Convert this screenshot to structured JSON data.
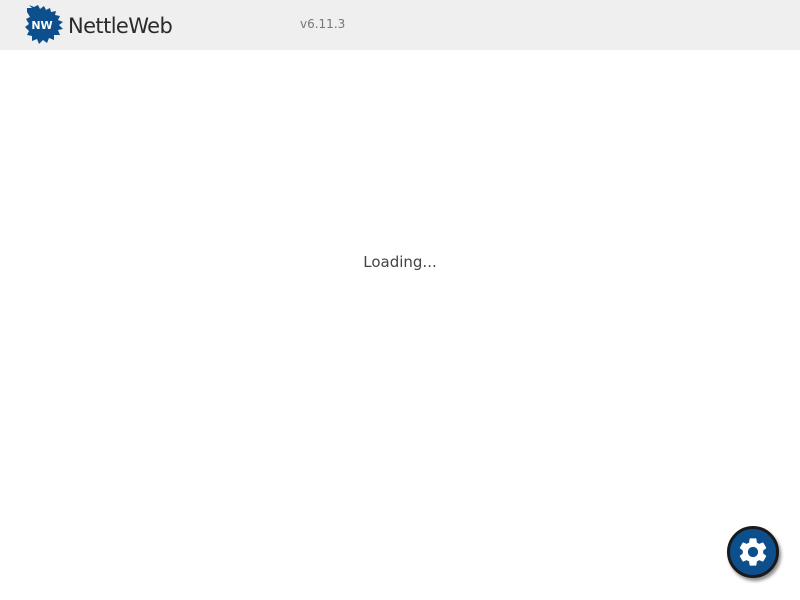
{
  "header": {
    "logo": {
      "badge_text": "NW",
      "name": "NettleWeb",
      "icon": "leaf-logo-icon",
      "leaf_color": "#0d4f8d"
    },
    "version": "v6.11.3"
  },
  "main": {
    "status_text": "Loading..."
  },
  "settings_button": {
    "icon": "gear-icon",
    "color": "#0d4f8d"
  }
}
